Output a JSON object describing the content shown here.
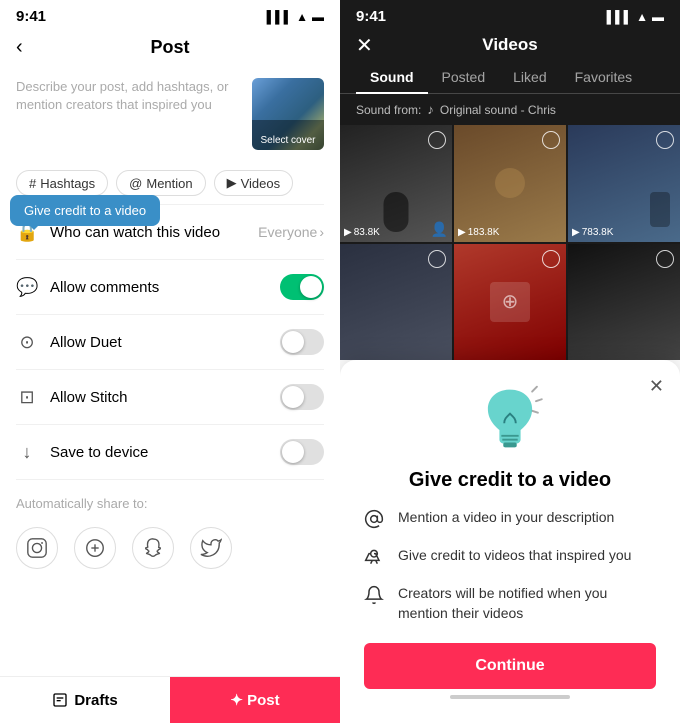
{
  "left": {
    "statusBar": {
      "time": "9:41",
      "icons": "▌▌▌ ▲ ▬"
    },
    "nav": {
      "back": "‹",
      "title": "Post"
    },
    "description": {
      "placeholder": "Describe your post, add hashtags, or mention creators that inspired you"
    },
    "coverLabel": "Select cover",
    "tags": [
      {
        "icon": "#",
        "label": "Hashtags"
      },
      {
        "icon": "@",
        "label": "Mention"
      },
      {
        "icon": "▶",
        "label": "Videos"
      }
    ],
    "tooltip": "Give credit to a video",
    "settings": [
      {
        "icon": "🔒",
        "label": "Who can watch this video",
        "value": "Everyone",
        "type": "link"
      },
      {
        "icon": "💬",
        "label": "Allow comments",
        "value": "",
        "type": "toggle-on"
      },
      {
        "icon": "⊙",
        "label": "Allow Duet",
        "value": "",
        "type": "toggle-off"
      },
      {
        "icon": "⊡",
        "label": "Allow Stitch",
        "value": "",
        "type": "toggle-off"
      },
      {
        "icon": "↓",
        "label": "Save to device",
        "value": "",
        "type": "toggle-off"
      }
    ],
    "autoShareLabel": "Automatically share to:",
    "socialIcons": [
      "📷",
      "⊕",
      "👻",
      "🐦"
    ],
    "draftsLabel": "Drafts",
    "postLabel": "✦ Post"
  },
  "right": {
    "statusBar": {
      "time": "9:41"
    },
    "close": "✕",
    "title": "Videos",
    "tabs": [
      {
        "label": "Sound",
        "active": true
      },
      {
        "label": "Posted",
        "active": false
      },
      {
        "label": "Liked",
        "active": false
      },
      {
        "label": "Favorites",
        "active": false
      }
    ],
    "soundFrom": "Sound from:",
    "soundNote": "♪",
    "soundName": "Original sound - Chris",
    "videos": [
      {
        "views": "83.8K",
        "hasDuet": true
      },
      {
        "views": "183.8K",
        "hasDuet": false
      },
      {
        "views": "783.8K",
        "hasDuet": false
      },
      {
        "views": "",
        "hasDuet": false
      },
      {
        "views": "",
        "hasDuet": false
      },
      {
        "views": "",
        "hasDuet": false
      }
    ]
  },
  "modal": {
    "close": "✕",
    "title": "Give credit to a video",
    "points": [
      {
        "icon": "@",
        "text": "Mention a video in your description"
      },
      {
        "icon": "✦",
        "text": "Give credit to videos that inspired you"
      },
      {
        "icon": "🔔",
        "text": "Creators will be notified when you mention their videos"
      }
    ],
    "continueLabel": "Continue"
  }
}
